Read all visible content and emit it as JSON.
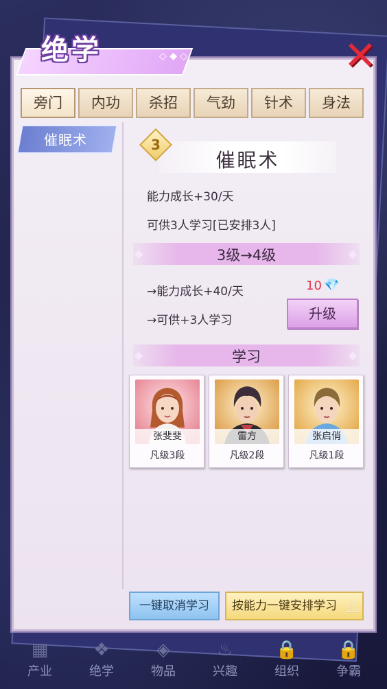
{
  "header": {
    "title": "绝学"
  },
  "tabs": [
    "旁门",
    "内功",
    "杀招",
    "气劲",
    "针术",
    "身法"
  ],
  "sidebar": {
    "items": [
      {
        "label": "催眠术"
      }
    ]
  },
  "skill": {
    "level": "3",
    "name": "催眠术",
    "growth": "能力成长+30/天",
    "capacity": "可供3人学习[已安排3人]"
  },
  "upgrade": {
    "section_label": "3级→4级",
    "next_growth": "→能力成长+40/天",
    "next_capacity": "→可供+3人学习",
    "cost": "10",
    "button_label": "升级"
  },
  "learners": {
    "section_label": "学习",
    "cards": [
      {
        "name": "张斐斐",
        "rank": "凡级3段"
      },
      {
        "name": "雷方",
        "rank": "凡级2段"
      },
      {
        "name": "张启俏",
        "rank": "凡级1段"
      }
    ]
  },
  "actions": {
    "cancel_all": "一键取消学习",
    "auto_assign": "按能力一键安排学习"
  },
  "bottom_nav": [
    "产业",
    "绝学",
    "物品",
    "兴趣",
    "组织",
    "争霸"
  ],
  "colors": {
    "accent": "#e7b6ea",
    "close": "#e22a3a",
    "cost": "#e0334a",
    "sidebar_active": "#6c7fd0"
  }
}
